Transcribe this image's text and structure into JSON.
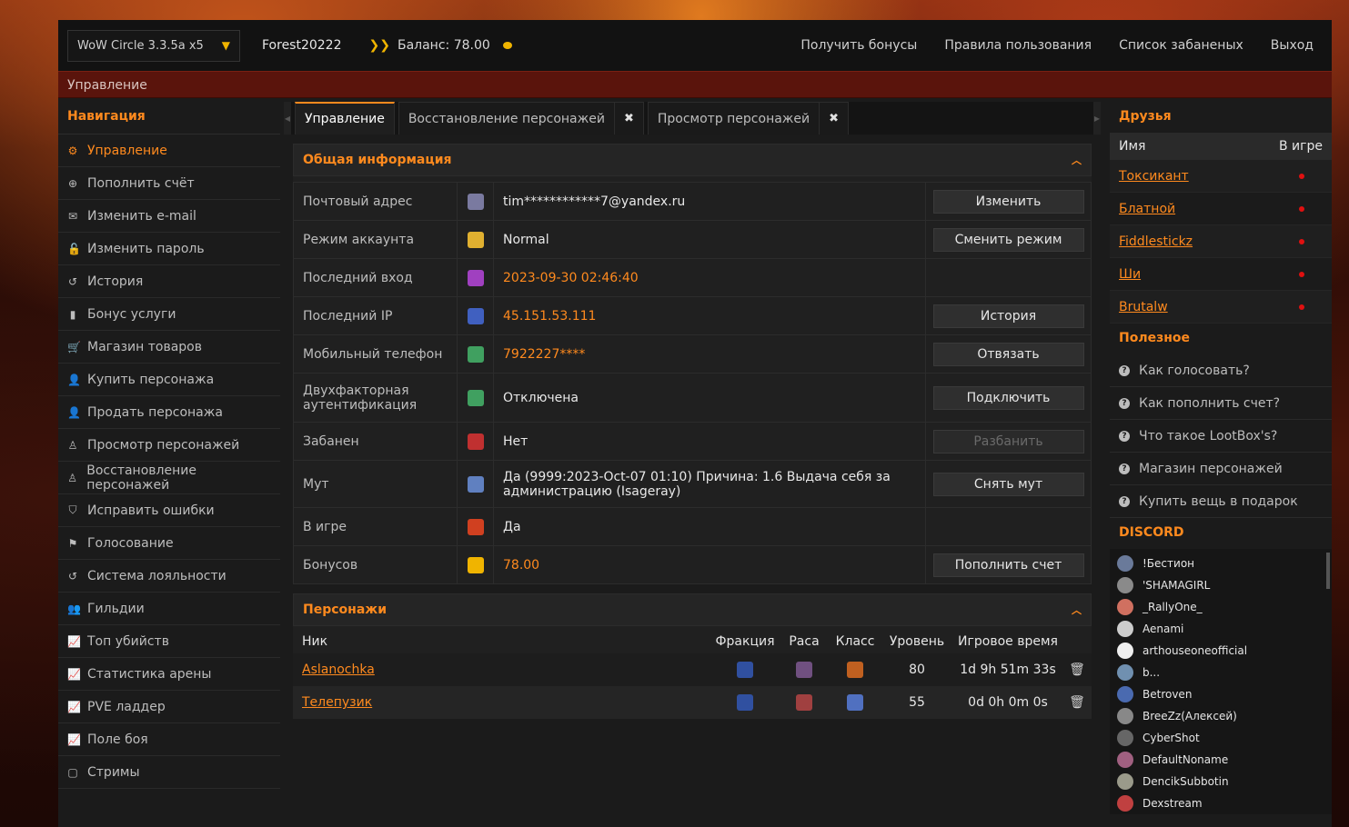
{
  "topbar": {
    "realm": "WoW Circle 3.3.5a x5",
    "username": "Forest20222",
    "balance_label": "Баланс: 78.00",
    "links": [
      "Получить бонусы",
      "Правила пользования",
      "Список забаненых",
      "Выход"
    ]
  },
  "section_title": "Управление",
  "nav": {
    "heading": "Навигация",
    "items": [
      {
        "label": "Управление",
        "icon": "gear-icon",
        "glyph": "⚙"
      },
      {
        "label": "Пополнить счёт",
        "icon": "plus-circle-icon",
        "glyph": "⊕"
      },
      {
        "label": "Изменить e-mail",
        "icon": "envelope-icon",
        "glyph": "✉"
      },
      {
        "label": "Изменить пароль",
        "icon": "lock-icon",
        "glyph": "🔓"
      },
      {
        "label": "История",
        "icon": "history-icon",
        "glyph": "↺"
      },
      {
        "label": "Бонус услуги",
        "icon": "bonus-icon",
        "glyph": "▮"
      },
      {
        "label": "Магазин товаров",
        "icon": "cart-icon",
        "glyph": "🛒"
      },
      {
        "label": "Купить персонажа",
        "icon": "user-icon",
        "glyph": "👤"
      },
      {
        "label": "Продать персонажа",
        "icon": "user-icon",
        "glyph": "👤"
      },
      {
        "label": "Просмотр персонажей",
        "icon": "male-icon",
        "glyph": "♙"
      },
      {
        "label": "Восстановление персонажей",
        "icon": "male-icon",
        "glyph": "♙"
      },
      {
        "label": "Исправить ошибки",
        "icon": "shield-icon",
        "glyph": "⛉"
      },
      {
        "label": "Голосование",
        "icon": "flag-icon",
        "glyph": "⚑"
      },
      {
        "label": "Система лояльности",
        "icon": "history-icon",
        "glyph": "↺"
      },
      {
        "label": "Гильдии",
        "icon": "users-icon",
        "glyph": "👥"
      },
      {
        "label": "Топ убийств",
        "icon": "chart-icon",
        "glyph": "📈"
      },
      {
        "label": "Статистика арены",
        "icon": "chart-icon",
        "glyph": "📈"
      },
      {
        "label": "PVE ладдер",
        "icon": "chart-icon",
        "glyph": "📈"
      },
      {
        "label": "Поле боя",
        "icon": "chart-icon",
        "glyph": "📈"
      },
      {
        "label": "Стримы",
        "icon": "twitch-icon",
        "glyph": "▢"
      }
    ]
  },
  "tabs": [
    {
      "label": "Управление",
      "active": true,
      "closable": false
    },
    {
      "label": "Восстановление персонажей",
      "active": false,
      "closable": true
    },
    {
      "label": "Просмотр персонажей",
      "active": false,
      "closable": true
    }
  ],
  "tab_close_glyph": "✖",
  "general": {
    "heading": "Общая информация",
    "rows": [
      {
        "label": "Почтовый адрес",
        "value": "tim************7@yandex.ru",
        "orange": false,
        "button": "Изменить",
        "icon_color": "#7a7aa0"
      },
      {
        "label": "Режим аккаунта",
        "value": "Normal",
        "orange": false,
        "button": "Сменить режим",
        "icon_color": "#e0b030"
      },
      {
        "label": "Последний вход",
        "value": "2023-09-30 02:46:40",
        "orange": true,
        "button": "",
        "icon_color": "#a040c0"
      },
      {
        "label": "Последний IP",
        "value": "45.151.53.111",
        "orange": true,
        "button": "История",
        "icon_color": "#4060c0"
      },
      {
        "label": "Мобильный телефон",
        "value": "7922227****",
        "orange": true,
        "button": "Отвязать",
        "icon_color": "#40a060"
      },
      {
        "label": "Двухфакторная аутентификация",
        "value": "Отключена",
        "orange": false,
        "button": "Подключить",
        "icon_color": "#40a060"
      },
      {
        "label": "Забанен",
        "value": "Нет",
        "orange": false,
        "button": "Разбанить",
        "disabled": true,
        "icon_color": "#c03030"
      },
      {
        "label": "Мут",
        "value": "Да (9999:2023-Oct-07 01:10) Причина: 1.6 Выдача себя за администрацию (Isageray)",
        "orange": false,
        "button": "Снять мут",
        "icon_color": "#6080c0"
      },
      {
        "label": "В игре",
        "value": "Да",
        "orange": false,
        "button": "",
        "icon_color": "#d04020"
      },
      {
        "label": "Бонусов",
        "value": "78.00",
        "orange": true,
        "button": "Пополнить счет",
        "icon_color": "#f0b400"
      }
    ]
  },
  "characters": {
    "heading": "Персонажи",
    "columns": [
      "Ник",
      "Фракция",
      "Раса",
      "Класс",
      "Уровень",
      "Игровое время"
    ],
    "rows": [
      {
        "nick": "Aslanochka",
        "level": "80",
        "time": "1d 9h 51m 33s",
        "faction_color": "#3050a0",
        "race_color": "#705080",
        "class_color": "#c06020"
      },
      {
        "nick": "Телепузик",
        "level": "55",
        "time": "0d 0h 0m 0s",
        "faction_color": "#3050a0",
        "race_color": "#a04040",
        "class_color": "#5070c0"
      }
    ]
  },
  "friends": {
    "heading": "Друзья",
    "col_name": "Имя",
    "col_ingame": "В игре",
    "list": [
      "Токсикант",
      "Блатной",
      "Fiddlestickz",
      "Ши",
      "Brutalw"
    ]
  },
  "useful": {
    "heading": "Полезное",
    "items": [
      "Как голосовать?",
      "Как пополнить счет?",
      "Что такое LootBox's?",
      "Магазин персонажей",
      "Купить вещь в подарок"
    ]
  },
  "discord": {
    "heading": "DISCORD",
    "users": [
      "!Бестион",
      "'SHAMAGIRL",
      "_RallyOne_",
      "Aenami",
      "arthouseoneofficial",
      "b...",
      "Betroven",
      "BreeZz(Алексей)",
      "CyberShot",
      "DefaultNoname",
      "DencikSubbotin",
      "Dexstream"
    ]
  },
  "colors": {
    "accent": "#ff8a1e",
    "online_dot": "#e01010"
  }
}
